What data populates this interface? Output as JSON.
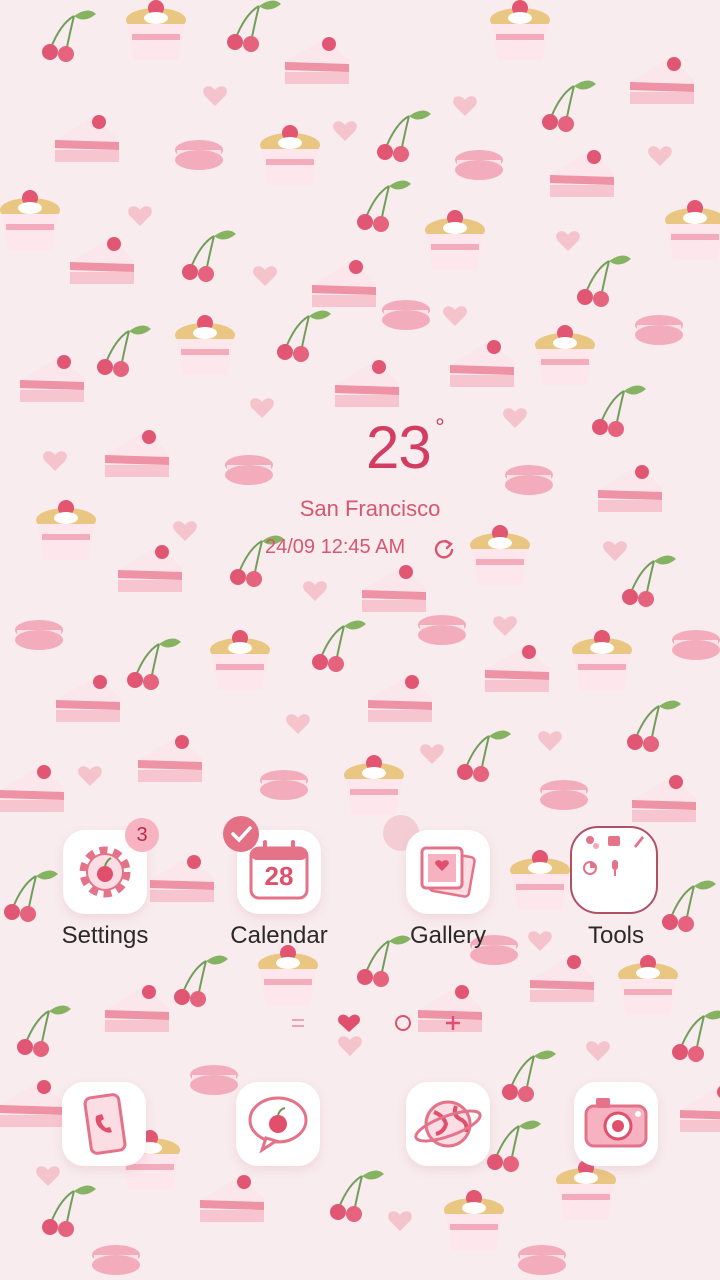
{
  "weather": {
    "icon": "partly-cloudy-icon",
    "temperature": "23",
    "unit": "°",
    "city": "San Francisco",
    "datetime": "24/09 12:45 AM"
  },
  "apps": [
    {
      "label": "Settings",
      "badge": "3"
    },
    {
      "label": "Calendar",
      "day": "28"
    },
    {
      "label": "Gallery"
    },
    {
      "label": "Tools"
    }
  ],
  "dock": [
    {
      "icon": "phone-icon"
    },
    {
      "icon": "messages-icon"
    },
    {
      "icon": "internet-icon"
    },
    {
      "icon": "camera-icon"
    }
  ],
  "page_indicator": [
    "menu",
    "home",
    "page",
    "add"
  ],
  "colors": {
    "background": "#f8ecee",
    "accent": "#d23e62",
    "icon_pink": "#e4738a"
  }
}
